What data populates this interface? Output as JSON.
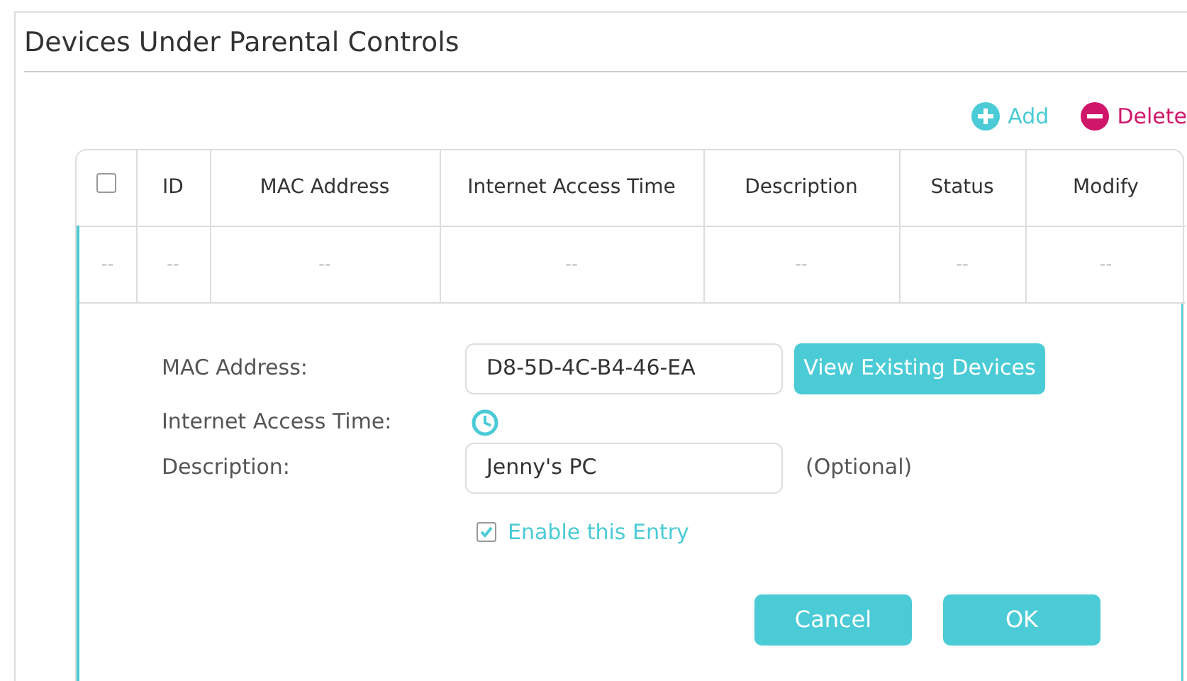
{
  "title": "Devices Under Parental Controls",
  "actions": [
    {
      "kind": "add",
      "label": "Add"
    },
    {
      "kind": "delete",
      "label": "Delete"
    }
  ],
  "table": {
    "select_all": {
      "checked": false
    },
    "columns": [
      "ID",
      "MAC Address",
      "Internet Access Time",
      "Description",
      "Status",
      "Modify"
    ],
    "rows": [
      {
        "select": "--",
        "cells": [
          "--",
          "--",
          "--",
          "--",
          "--",
          "--"
        ]
      }
    ]
  },
  "editor": {
    "mac_label": "MAC Address:",
    "mac_value": "D8-5D-4C-B4-46-EA",
    "view_button": "View Existing Devices",
    "time_label": "Internet Access Time:",
    "desc_label": "Description:",
    "desc_value": "Jenny's PC",
    "optional": "(Optional)",
    "enable": {
      "label": "Enable this Entry",
      "checked": true
    },
    "buttons": [
      "Cancel",
      "OK"
    ]
  }
}
